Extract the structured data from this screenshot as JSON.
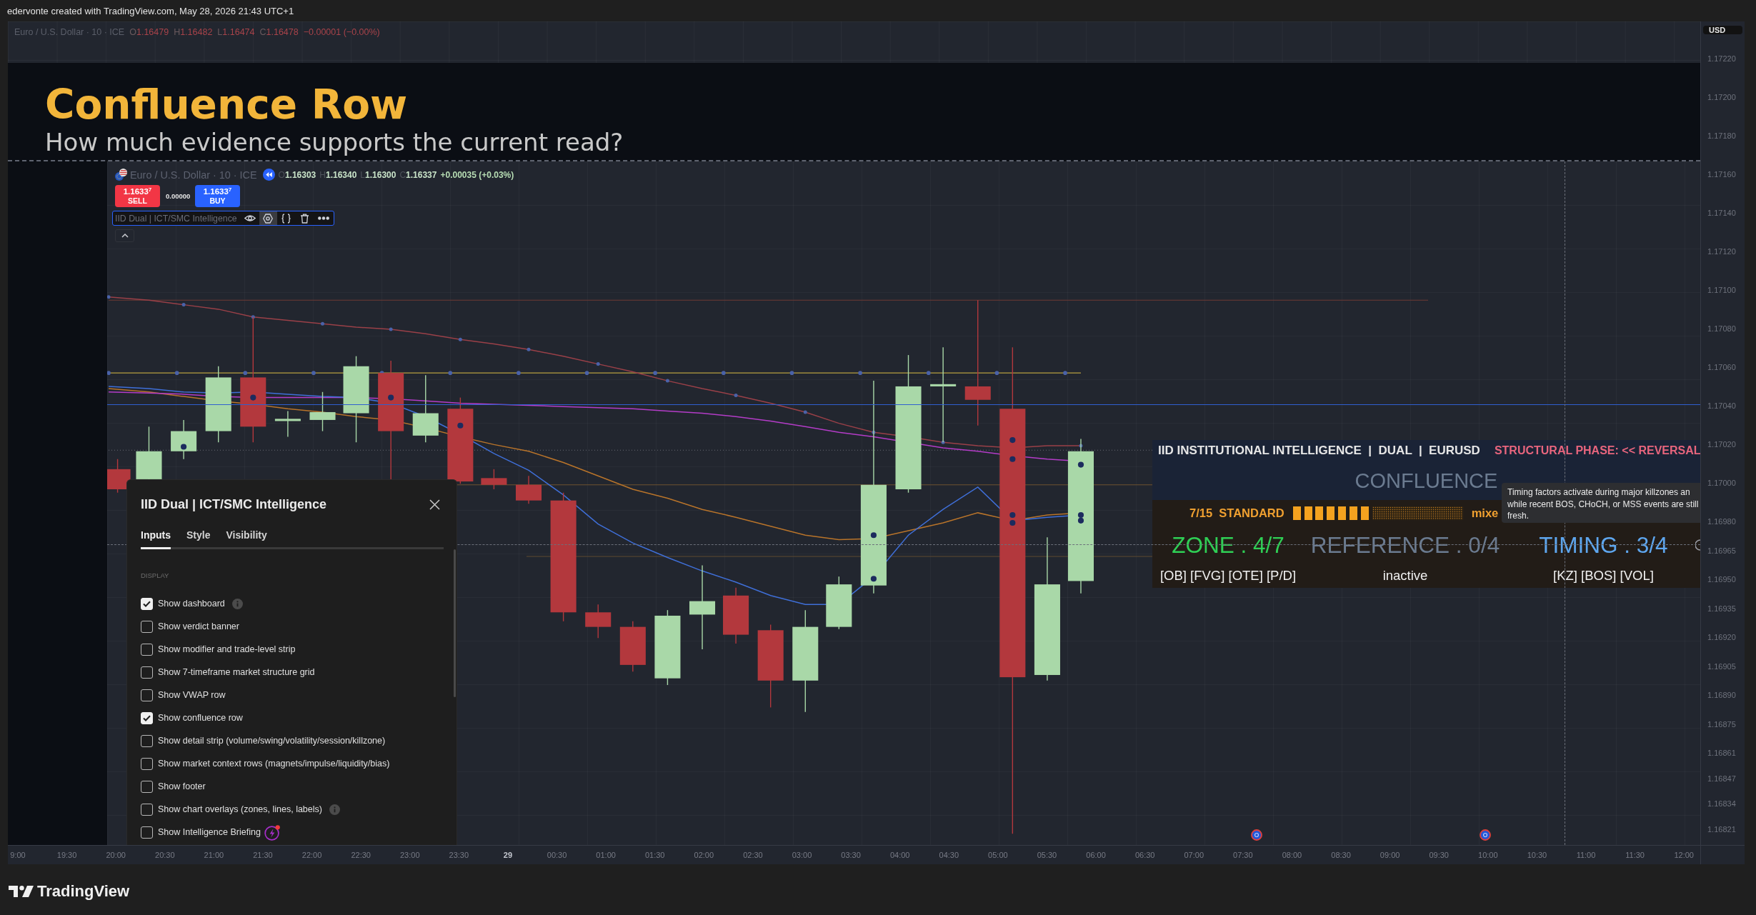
{
  "snapshot_caption": "edervonte created with TradingView.com, May 28, 2026 21:43 UTC+1",
  "chart_legend": {
    "symbol": "Euro / U.S. Dollar · 10 · ICE",
    "ohlc": [
      {
        "label": "O",
        "value": "1.16479"
      },
      {
        "label": "H",
        "value": "1.16482"
      },
      {
        "label": "L",
        "value": "1.16474"
      },
      {
        "label": "C",
        "value": "1.16478"
      }
    ],
    "change": "−0.00001 (−0.00%)"
  },
  "banner": {
    "title": "Confluence Row",
    "subtitle": "How much evidence supports the current read?"
  },
  "replay_chart": {
    "legend": {
      "symbol": "Euro / U.S. Dollar · 10 · ICE",
      "ohlc": [
        {
          "label": "O",
          "value": "1.16303"
        },
        {
          "label": "H",
          "value": "1.16340"
        },
        {
          "label": "L",
          "value": "1.16300"
        },
        {
          "label": "C",
          "value": "1.16337"
        }
      ],
      "change": "+0.00035 (+0.03%)"
    },
    "trade_buttons": [
      {
        "kind": "sell",
        "price": "1.1633$^{7}$",
        "label": "SELL"
      },
      {
        "kind": "buy",
        "price": "1.1633$^{7}$",
        "label": "BUY"
      }
    ],
    "spread": "0.00000",
    "indicator": {
      "name": "IID Dual | ICT/SMC Intelligence",
      "settings_active": true
    },
    "dashboard": {
      "header": {
        "title": "IID INSTITUTIONAL INTELLIGENCE  |  DUAL  |  EURUSD",
        "phase": "STRUCTURAL PHASE: << REVERSAL"
      },
      "section": "CONFLUENCE",
      "score": {
        "label": "7/15  STANDARD",
        "level": 0.4667,
        "status": "mixe"
      },
      "pillars": [
        {
          "label": "ZONE . 4/7",
          "detail": "[OB] [FVG] [OTE] [P/D]",
          "color": "#2fcf55"
        },
        {
          "label": "REFERENCE . 0/4",
          "detail": "inactive",
          "color": "#6b7b90"
        },
        {
          "label": "TIMING . 3/4",
          "detail": "[KZ] [BOS] [VOL]",
          "color": "#5ea6ee"
        }
      ]
    },
    "tooltip": {
      "lines": [
        "Timing factors activate during major killzones an",
        "while recent BOS, CHoCH, or MSS events are still",
        "fresh."
      ]
    },
    "settings_dialog": {
      "title": "IID Dual | ICT/SMC Intelligence",
      "tabs": [
        {
          "label": "Inputs",
          "selected": true
        },
        {
          "label": "Style",
          "selected": false
        },
        {
          "label": "Visibility",
          "selected": false
        }
      ],
      "section": "DISPLAY",
      "options": [
        {
          "label": "Show dashboard",
          "checked": true,
          "kind": "info"
        },
        {
          "label": "Show verdict banner",
          "checked": false,
          "kind": "plain"
        },
        {
          "label": "Show modifier and trade-level strip",
          "checked": false,
          "kind": "plain"
        },
        {
          "label": "Show 7-timeframe market structure grid",
          "checked": false,
          "kind": "plain"
        },
        {
          "label": "Show VWAP row",
          "checked": false,
          "kind": "plain"
        },
        {
          "label": "Show confluence row",
          "checked": true,
          "kind": "plain"
        },
        {
          "label": "Show detail strip (volume/swing/volatility/session/killzone)",
          "checked": false,
          "kind": "plain"
        },
        {
          "label": "Show market context rows (magnets/impulse/liquidity/bias)",
          "checked": false,
          "kind": "plain"
        },
        {
          "label": "Show footer",
          "checked": false,
          "kind": "plain"
        },
        {
          "label": "Show chart overlays (zones, lines, labels)",
          "checked": false,
          "kind": "info"
        },
        {
          "label": "Show Intelligence Briefing",
          "checked": false,
          "kind": "featured"
        }
      ]
    }
  },
  "price_axis": {
    "currency": "USD",
    "labels": [
      "1.17220",
      "1.17200",
      "1.17180",
      "1.17160",
      "1.17140",
      "1.17120",
      "1.17100",
      "1.17080",
      "1.17060",
      "1.17040",
      "1.17020",
      "1.17000",
      "1.16980",
      "1.16965",
      "1.16950",
      "1.16935",
      "1.16920",
      "1.16905",
      "1.16890",
      "1.16875",
      "1.16861",
      "1.16847",
      "1.16834",
      "1.16821"
    ]
  },
  "time_axis": {
    "labels": [
      {
        "text": "9:00",
        "kind": "time"
      },
      {
        "text": "19:30",
        "kind": "time"
      },
      {
        "text": "20:00",
        "kind": "time"
      },
      {
        "text": "20:30",
        "kind": "time"
      },
      {
        "text": "21:00",
        "kind": "time"
      },
      {
        "text": "21:30",
        "kind": "time"
      },
      {
        "text": "22:00",
        "kind": "time"
      },
      {
        "text": "22:30",
        "kind": "time"
      },
      {
        "text": "23:00",
        "kind": "time"
      },
      {
        "text": "23:30",
        "kind": "time"
      },
      {
        "text": "29",
        "kind": "day"
      },
      {
        "text": "00:30",
        "kind": "time"
      },
      {
        "text": "01:00",
        "kind": "time"
      },
      {
        "text": "01:30",
        "kind": "time"
      },
      {
        "text": "02:00",
        "kind": "time"
      },
      {
        "text": "02:30",
        "kind": "time"
      },
      {
        "text": "03:00",
        "kind": "time"
      },
      {
        "text": "03:30",
        "kind": "time"
      },
      {
        "text": "04:00",
        "kind": "time"
      },
      {
        "text": "04:30",
        "kind": "time"
      },
      {
        "text": "05:00",
        "kind": "time"
      },
      {
        "text": "05:30",
        "kind": "time"
      },
      {
        "text": "06:00",
        "kind": "time"
      },
      {
        "text": "06:30",
        "kind": "time"
      },
      {
        "text": "07:00",
        "kind": "time"
      },
      {
        "text": "07:30",
        "kind": "time"
      },
      {
        "text": "08:00",
        "kind": "time"
      },
      {
        "text": "08:30",
        "kind": "time"
      },
      {
        "text": "09:00",
        "kind": "time"
      },
      {
        "text": "09:30",
        "kind": "time"
      },
      {
        "text": "10:00",
        "kind": "time"
      },
      {
        "text": "10:30",
        "kind": "time"
      },
      {
        "text": "11:00",
        "kind": "time"
      },
      {
        "text": "11:30",
        "kind": "time"
      },
      {
        "text": "12:00",
        "kind": "time"
      }
    ]
  },
  "footer": {
    "logo_text": "TradingView"
  }
}
